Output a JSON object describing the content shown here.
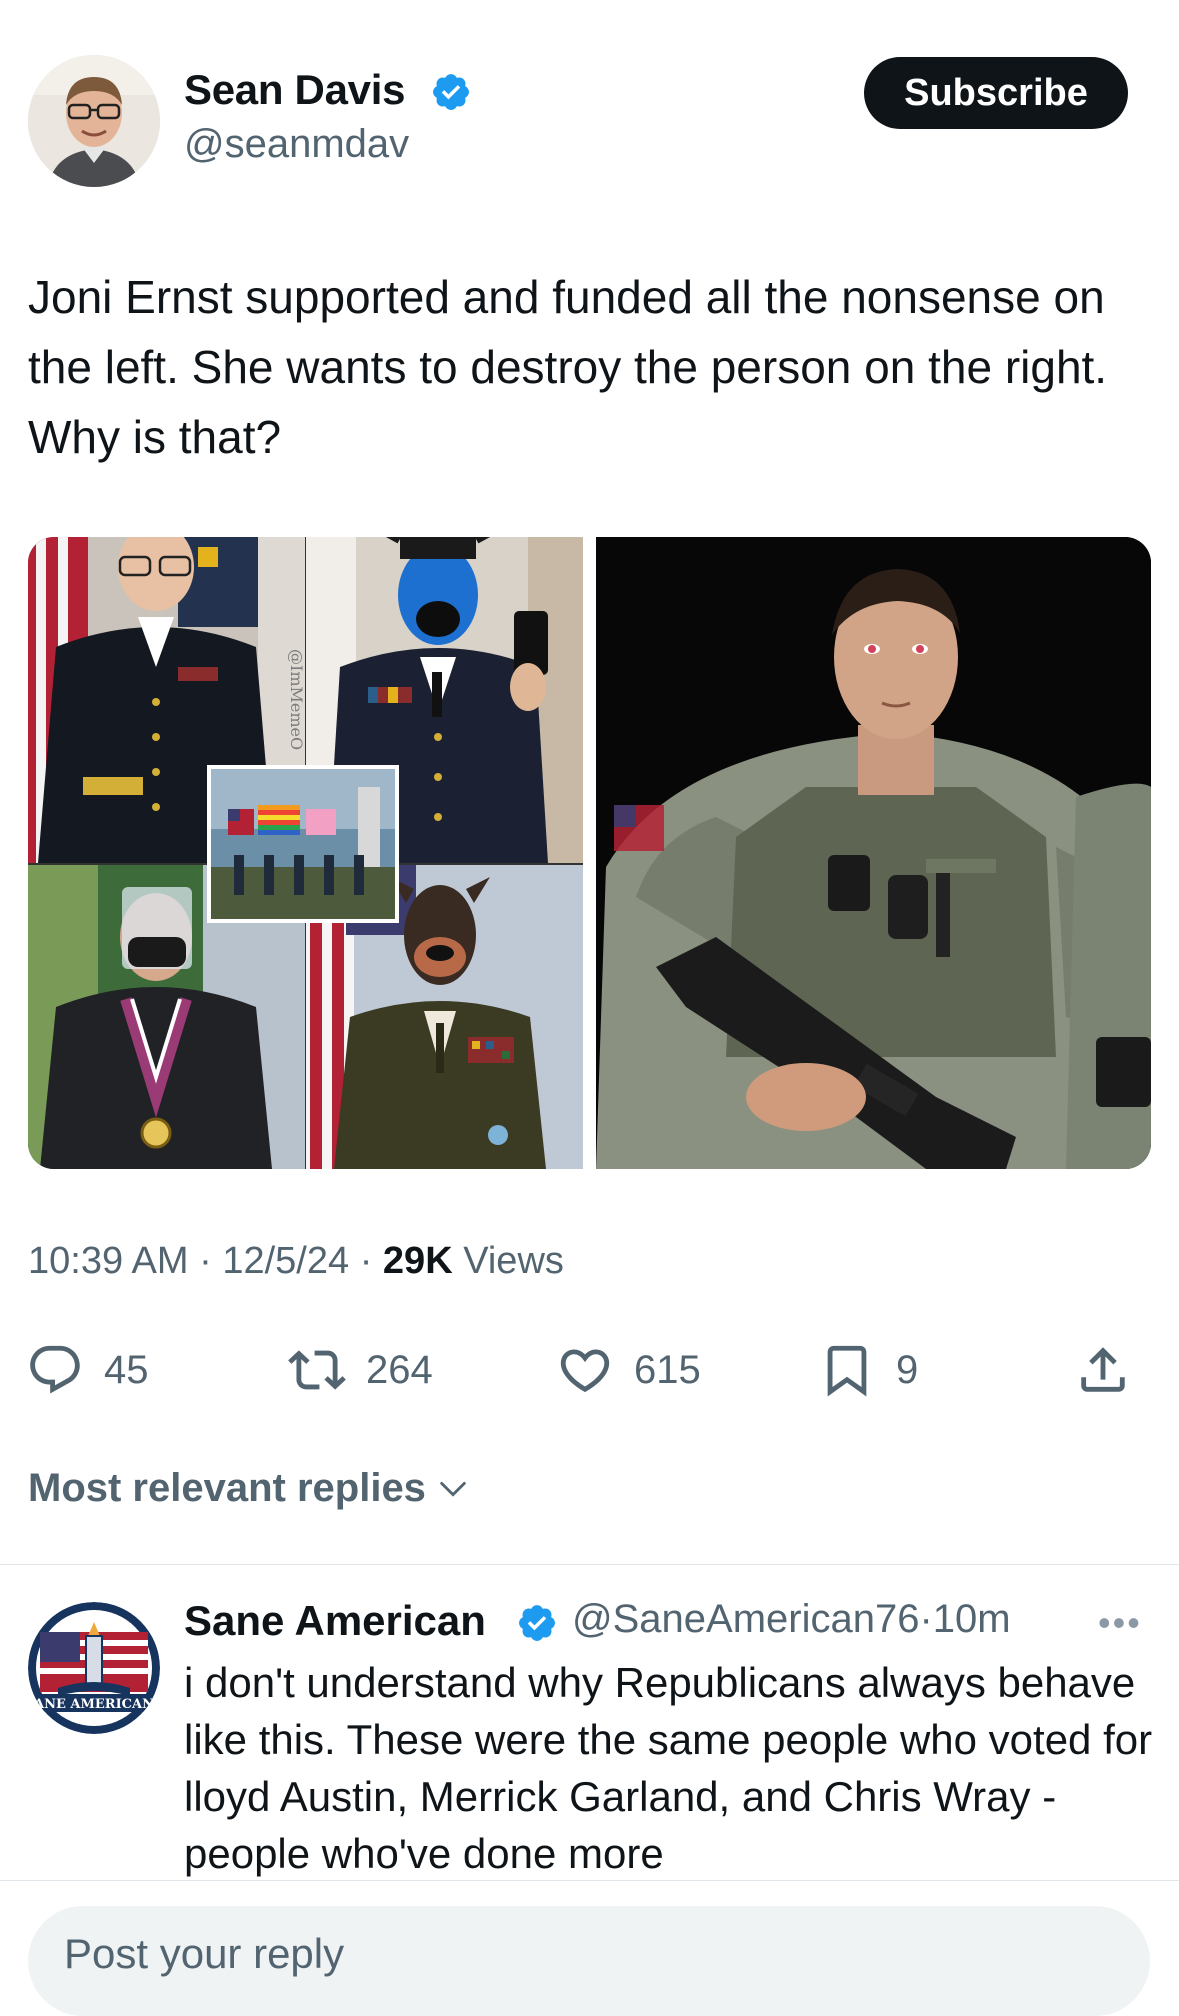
{
  "tweet": {
    "author_name": "Sean Davis",
    "author_handle": "@seanmdav",
    "subscribe_label": "Subscribe",
    "text": "Joni Ernst supported and funded all the nonsense on the left. She wants to destroy the person on the right. Why is that?",
    "media_watermark": "@ImMemeO",
    "time": "10:39 AM",
    "date": "12/5/24",
    "views_count": "29K",
    "views_label": "Views",
    "meta_sep": "·",
    "replies": "45",
    "reposts": "264",
    "likes": "615",
    "bookmarks": "9"
  },
  "replies_sort_label": "Most relevant replies",
  "reply": {
    "author_name": "Sane American",
    "author_handle": "@SaneAmerican76",
    "time_sep": "·",
    "time": "10m",
    "more": "•••",
    "avatar_text": "ANE AMERICAN",
    "text": "i don't understand why Republicans always behave like this. These were the same people who voted for lloyd Austin, Merrick Garland, and Chris Wray - people who've done more"
  },
  "composer": {
    "placeholder": "Post your reply"
  },
  "colors": {
    "text": "#0f1419",
    "secondary": "#536471",
    "verified": "#1d9bf0",
    "button_bg": "#0f1419",
    "composer_bg": "#eff3f4"
  },
  "icons": [
    "verified-badge-icon",
    "reply-icon",
    "repost-icon",
    "like-icon",
    "bookmark-icon",
    "share-icon",
    "chevron-down-icon",
    "more-icon"
  ]
}
